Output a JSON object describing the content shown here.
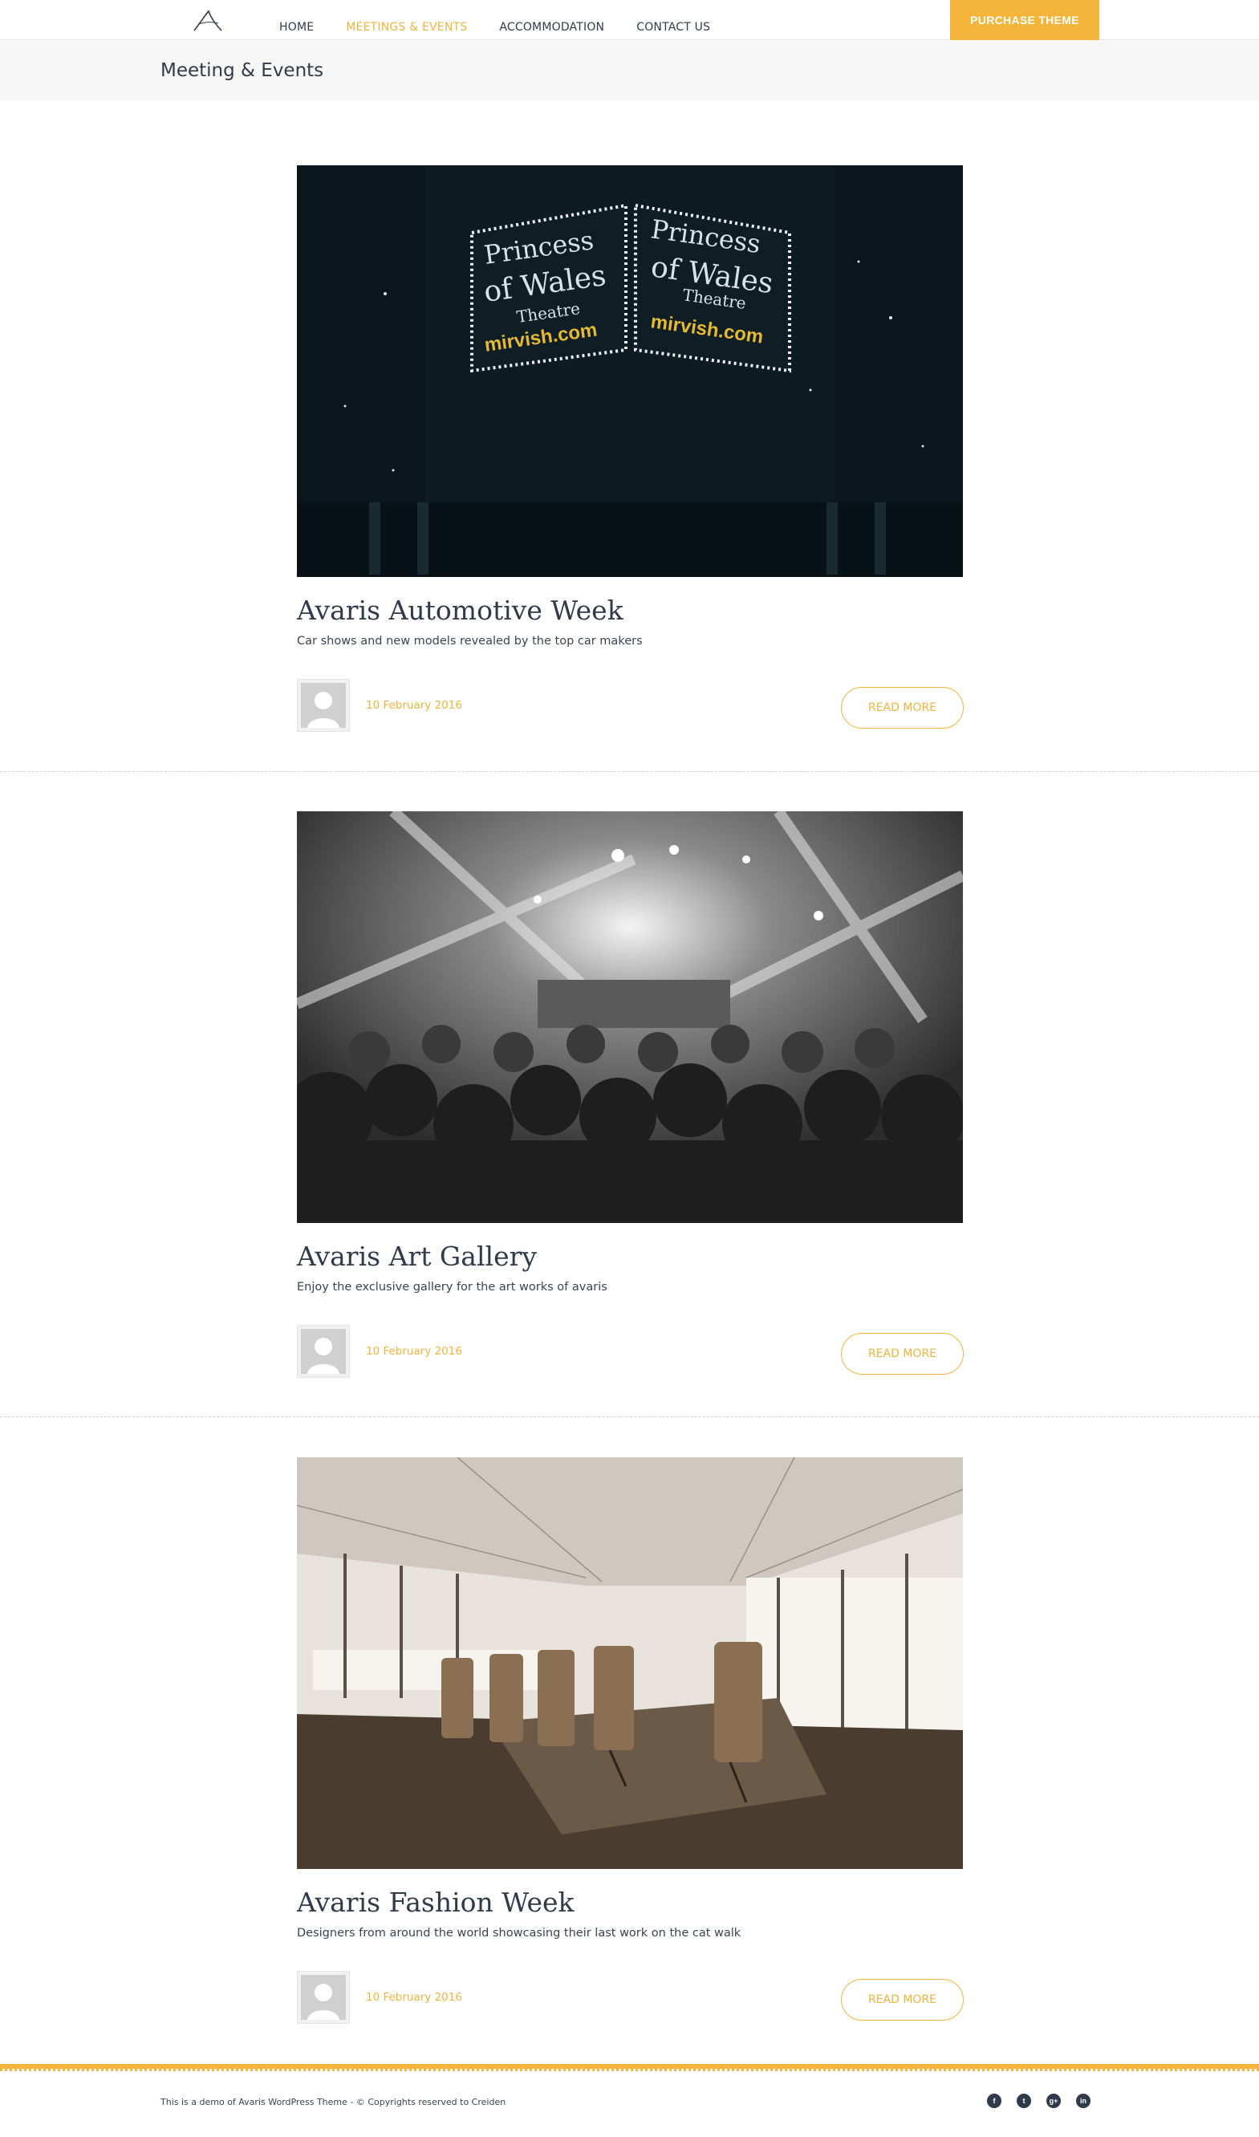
{
  "header": {
    "logo_alt": "Avaris",
    "nav": [
      {
        "label": "HOME",
        "active": false
      },
      {
        "label": "MEETINGS & EVENTS",
        "active": true
      },
      {
        "label": "ACCOMMODATION",
        "active": false
      },
      {
        "label": "CONTACT US",
        "active": false
      }
    ],
    "purchase_label": "PURCHASE THEME"
  },
  "page": {
    "title": "Meeting & Events"
  },
  "posts": [
    {
      "title": "Avaris Automotive Week",
      "description": "Car shows and new models revealed by the top car makers",
      "date": "10 February 2016",
      "read_more": "READ MORE",
      "image": {
        "sign_line1": "Princess",
        "sign_line2": "of Wales",
        "sign_line3": "Theatre",
        "sign_line4": "mirvish.com"
      }
    },
    {
      "title": "Avaris Art Gallery",
      "description": "Enjoy the exclusive gallery for the art works of avaris",
      "date": "10 February 2016",
      "read_more": "READ MORE"
    },
    {
      "title": "Avaris Fashion Week",
      "description": "Designers from around the world showcasing their last work on the cat walk",
      "date": "10 February 2016",
      "read_more": "READ MORE"
    }
  ],
  "footer": {
    "copyright": "This is a demo of Avaris WordPress Theme - © Copyrights reserved to Creiden",
    "socials": [
      {
        "icon": "facebook-icon",
        "glyph": "f"
      },
      {
        "icon": "twitter-icon",
        "glyph": "t"
      },
      {
        "icon": "google-plus-icon",
        "glyph": "g+"
      },
      {
        "icon": "linkedin-icon",
        "glyph": "in"
      }
    ]
  },
  "colors": {
    "accent": "#f4b53a",
    "text": "#2f3a4a",
    "band": "#f7f7f7"
  }
}
